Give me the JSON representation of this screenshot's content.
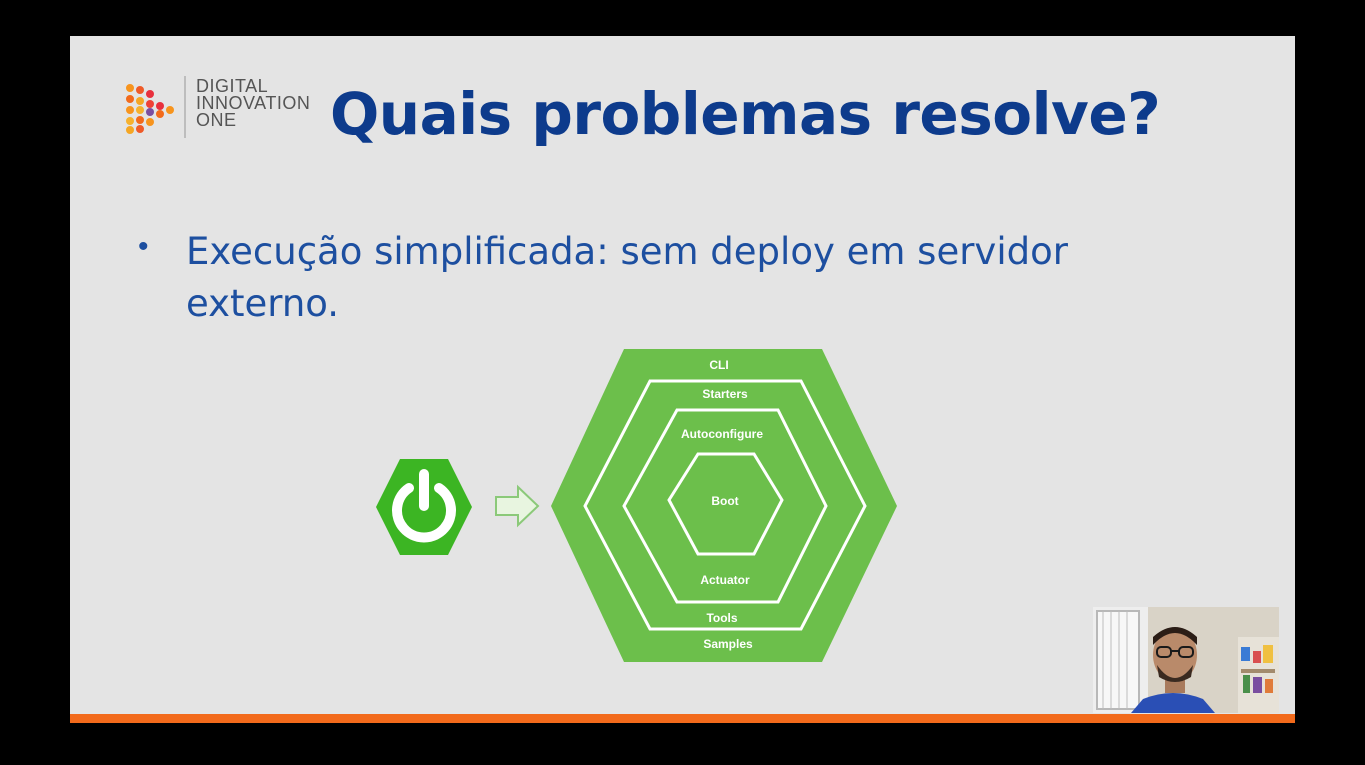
{
  "logo": {
    "line1": "DIGITAL",
    "line2": "INNOVATION",
    "line3": "ONE"
  },
  "slide": {
    "title": "Quais problemas resolve?",
    "bullet_marker": "•",
    "bullet_text": "Execução simplificada: sem deploy em servidor externo."
  },
  "diagram": {
    "layers": {
      "cli": "CLI",
      "starters": "Starters",
      "autoconfigure": "Autoconfigure",
      "boot": "Boot",
      "actuator": "Actuator",
      "tools": "Tools",
      "samples": "Samples"
    },
    "icons": [
      "power-icon",
      "arrow-right-icon"
    ]
  },
  "colors": {
    "title": "#0d3b8c",
    "bullet": "#1d4fa0",
    "spring_green": "#6cbf4b",
    "power_green": "#3cb523",
    "accent_orange": "#f26a1b"
  }
}
